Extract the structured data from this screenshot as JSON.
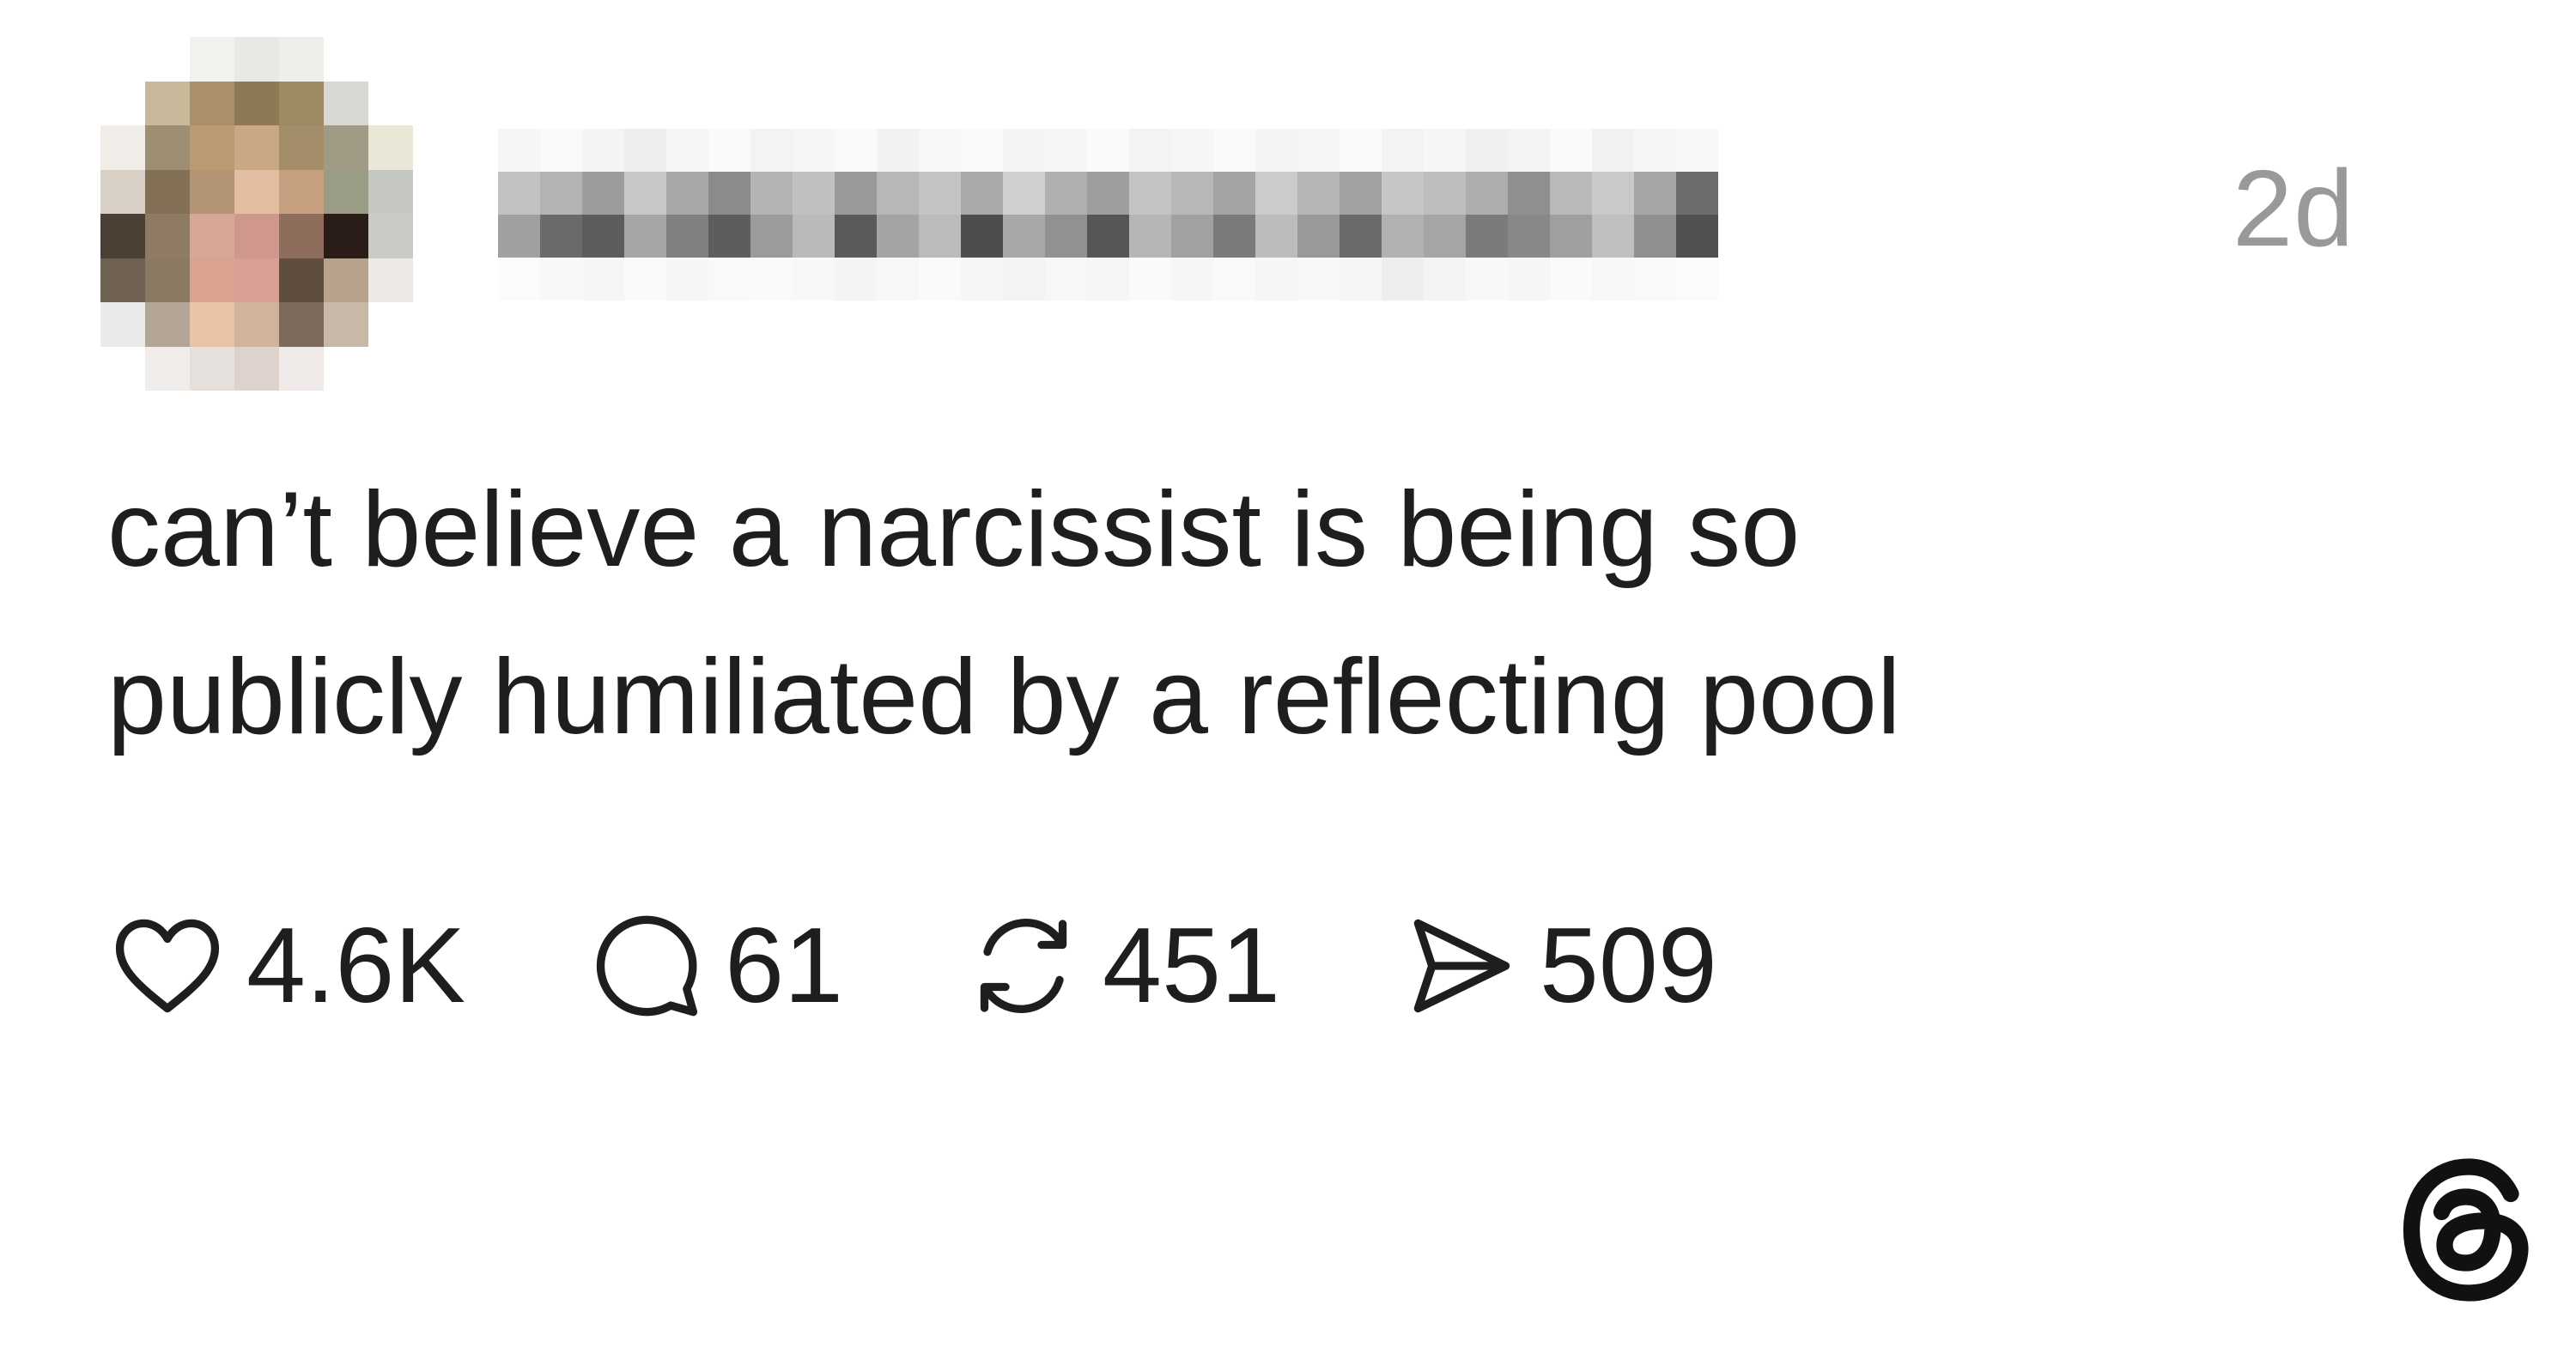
{
  "post": {
    "timestamp": "2d",
    "text_line1": "can’t believe a narcissist is being so",
    "text_line2": "publicly humiliated by a reflecting pool"
  },
  "actions": {
    "likes": "4.6K",
    "replies": "61",
    "reposts": "451",
    "shares": "509"
  },
  "icons": {
    "like": "heart-icon",
    "reply": "speech-bubble-icon",
    "repost": "repost-arrows-icon",
    "share": "send-icon",
    "brand": "threads-logo-icon"
  },
  "colors": {
    "text": "#1e1e1e",
    "muted": "#999999",
    "background": "#ffffff"
  },
  "avatar_palette": [
    "#ffffff",
    "#ffffff",
    "#f1f1ee",
    "#e8e8e4",
    "#eeeeea",
    "#ffffff",
    "#ffffff",
    "#ffffff",
    "#c9b99b",
    "#a98f6a",
    "#8d7a55",
    "#9b8a62",
    "#d9d7d2",
    "#ffffff",
    "#f0ede8",
    "#9e8e73",
    "#b99a73",
    "#c9a983",
    "#a48e6a",
    "#a09b84",
    "#e9e7d6",
    "#d8d0c4",
    "#847056",
    "#b39576",
    "#e4bea0",
    "#c6a07e",
    "#9a9c86",
    "#c5c8c2",
    "#4c3f34",
    "#8f7a64",
    "#d7a795",
    "#d0978e",
    "#8f6d5d",
    "#2a1c16",
    "#c8cbc6",
    "#6f6252",
    "#8a7a63",
    "#d9a38e",
    "#d8a095",
    "#5f4d40",
    "#b8a28c",
    "#ece9e6",
    "#eaeae8",
    "#b4a697",
    "#e8c3a6",
    "#d1b29b",
    "#7e6a5a",
    "#c7b8a8",
    "#ffffff",
    "#ffffff",
    "#f0ecea",
    "#e6e0dc",
    "#ddd2cc",
    "#efeae8",
    "#ffffff",
    "#ffffff"
  ],
  "username_palette": [
    "#f6f6f6",
    "#fafafa",
    "#f4f4f4",
    "#eeeeee",
    "#f5f5f5",
    "#fafafa",
    "#f3f3f3",
    "#f6f6f6",
    "#fafafa",
    "#f2f2f2",
    "#f7f7f7",
    "#fafafa",
    "#f4f4f4",
    "#f6f6f6",
    "#fafafa",
    "#f3f3f3",
    "#f6f6f6",
    "#fafafa",
    "#f4f4f4",
    "#f6f6f6",
    "#fafafa",
    "#f3f3f3",
    "#f6f6f6",
    "#f0f0f0",
    "#f4f4f4",
    "#fafafa",
    "#f1f1f1",
    "#f5f5f5",
    "#f8f8f8",
    "#ffffff",
    "#c2c2c2",
    "#b3b3b3",
    "#9c9c9c",
    "#c8c8c8",
    "#a7a7a7",
    "#8b8b8b",
    "#b4b4b4",
    "#c0c0c0",
    "#9a9a9a",
    "#b7b7b7",
    "#c4c4c4",
    "#a9a9a9",
    "#cfcfcf",
    "#b0b0b0",
    "#9e9e9e",
    "#c3c3c3",
    "#b8b8b8",
    "#a3a3a3",
    "#cbcbcb",
    "#b5b5b5",
    "#a2a2a2",
    "#c6c6c6",
    "#bdbdbd",
    "#adadad",
    "#8f8f8f",
    "#b9b9b9",
    "#c9c9c9",
    "#a6a6a6",
    "#6d6d6d",
    "#ffffff",
    "#a0a0a0",
    "#6a6a6a",
    "#5c5c5c",
    "#a6a6a6",
    "#808080",
    "#5d5d5d",
    "#9b9b9b",
    "#bababa",
    "#5a5a5a",
    "#a4a4a4",
    "#bbbbbb",
    "#4d4d4d",
    "#a8a8a8",
    "#919191",
    "#565656",
    "#b6b6b6",
    "#a1a1a1",
    "#7a7a7a",
    "#bcbcbc",
    "#999999",
    "#6b6b6b",
    "#b1b1b1",
    "#a5a5a5",
    "#7b7b7b",
    "#888888",
    "#9f9f9f",
    "#bfbfbf",
    "#909090",
    "#505050",
    "#ffffff",
    "#fbfbfb",
    "#f8f8f8",
    "#f6f6f6",
    "#fafafa",
    "#f6f6f6",
    "#f9f9f9",
    "#fafafa",
    "#f8f8f8",
    "#f4f4f4",
    "#f7f7f7",
    "#fafafa",
    "#f6f6f6",
    "#f3f3f3",
    "#f7f7f7",
    "#f5f5f5",
    "#fafafa",
    "#f6f6f6",
    "#f9f9f9",
    "#f6f6f6",
    "#f8f8f8",
    "#f5f5f5",
    "#eeeeee",
    "#f4f4f4",
    "#f8f8f8",
    "#f6f6f6",
    "#fafafa",
    "#f7f7f7",
    "#f9f9f9",
    "#fbfbfb",
    "#ffffff"
  ]
}
